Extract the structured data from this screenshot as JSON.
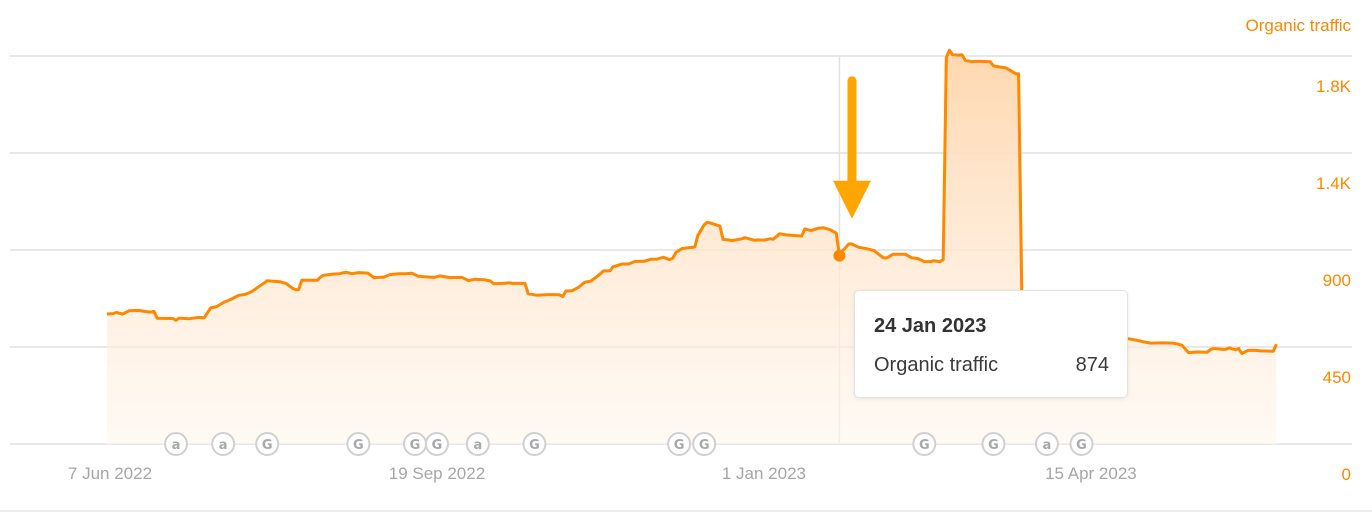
{
  "chart_data": {
    "type": "area",
    "title": "",
    "series_name": "Organic traffic",
    "xlabel": "",
    "ylabel": "Organic traffic",
    "axis_position": "right",
    "grid": true,
    "ylim": [
      0,
      1800
    ],
    "y_ticks": [
      {
        "value": 0,
        "label": "0"
      },
      {
        "value": 450,
        "label": "450"
      },
      {
        "value": 900,
        "label": "900"
      },
      {
        "value": 1350,
        "label": "1.4K"
      },
      {
        "value": 1800,
        "label": "1.8K"
      }
    ],
    "x_start_date": "2022-06-07",
    "x_range_days": [
      -1,
      372
    ],
    "x_ticks": [
      {
        "day": 0,
        "label": "7 Jun 2022"
      },
      {
        "day": 104,
        "label": "19 Sep 2022"
      },
      {
        "day": 208,
        "label": "1 Jan 2023"
      },
      {
        "day": 312,
        "label": "15 Apr 2023"
      }
    ],
    "color": "#ff8800",
    "points": [
      [
        -1,
        603
      ],
      [
        1,
        605
      ],
      [
        2,
        610
      ],
      [
        4,
        603
      ],
      [
        6,
        618
      ],
      [
        9,
        620
      ],
      [
        11,
        615
      ],
      [
        13,
        612
      ],
      [
        14,
        615
      ],
      [
        15,
        583
      ],
      [
        20,
        582
      ],
      [
        21,
        574
      ],
      [
        22,
        584
      ],
      [
        25,
        581
      ],
      [
        28,
        587
      ],
      [
        30,
        586
      ],
      [
        32,
        631
      ],
      [
        34,
        638
      ],
      [
        36,
        656
      ],
      [
        38,
        668
      ],
      [
        41,
        690
      ],
      [
        43,
        694
      ],
      [
        45,
        706
      ],
      [
        47,
        727
      ],
      [
        50,
        757
      ],
      [
        52,
        755
      ],
      [
        54,
        753
      ],
      [
        56,
        745
      ],
      [
        58,
        723
      ],
      [
        59,
        716
      ],
      [
        60,
        716
      ],
      [
        61,
        760
      ],
      [
        66,
        760
      ],
      [
        67,
        775
      ],
      [
        68,
        783
      ],
      [
        71,
        788
      ],
      [
        73,
        790
      ],
      [
        75,
        797
      ],
      [
        77,
        790
      ],
      [
        79,
        795
      ],
      [
        82,
        793
      ],
      [
        84,
        772
      ],
      [
        87,
        774
      ],
      [
        89,
        786
      ],
      [
        92,
        790
      ],
      [
        94,
        790
      ],
      [
        96,
        792
      ],
      [
        98,
        779
      ],
      [
        100,
        776
      ],
      [
        103,
        773
      ],
      [
        105,
        780
      ],
      [
        108,
        772
      ],
      [
        112,
        773
      ],
      [
        114,
        758
      ],
      [
        116,
        764
      ],
      [
        119,
        762
      ],
      [
        121,
        756
      ],
      [
        122,
        743
      ],
      [
        125,
        745
      ],
      [
        127,
        748
      ],
      [
        128,
        745
      ],
      [
        132,
        745
      ],
      [
        133,
        697
      ],
      [
        136,
        690
      ],
      [
        139,
        693
      ],
      [
        141,
        693
      ],
      [
        143,
        692
      ],
      [
        144,
        684
      ],
      [
        145,
        710
      ],
      [
        147,
        711
      ],
      [
        149,
        727
      ],
      [
        151,
        750
      ],
      [
        153,
        756
      ],
      [
        155,
        778
      ],
      [
        157,
        803
      ],
      [
        159,
        803
      ],
      [
        160,
        822
      ],
      [
        163,
        835
      ],
      [
        165,
        835
      ],
      [
        167,
        847
      ],
      [
        170,
        848
      ],
      [
        172,
        857
      ],
      [
        174,
        858
      ],
      [
        176,
        866
      ],
      [
        178,
        855
      ],
      [
        179,
        862
      ],
      [
        180,
        889
      ],
      [
        182,
        907
      ],
      [
        184,
        910
      ],
      [
        186,
        914
      ],
      [
        187,
        968
      ],
      [
        189,
        1017
      ],
      [
        190,
        1029
      ],
      [
        192,
        1020
      ],
      [
        194,
        1011
      ],
      [
        195,
        949
      ],
      [
        198,
        944
      ],
      [
        201,
        952
      ],
      [
        202,
        957
      ],
      [
        205,
        945
      ],
      [
        206,
        947
      ],
      [
        208,
        946
      ],
      [
        210,
        952
      ],
      [
        211,
        950
      ],
      [
        213,
        975
      ],
      [
        215,
        970
      ],
      [
        218,
        967
      ],
      [
        220,
        965
      ],
      [
        221,
        998
      ],
      [
        223,
        990
      ],
      [
        225,
        1000
      ],
      [
        227,
        1003
      ],
      [
        229,
        994
      ],
      [
        231,
        978
      ],
      [
        232,
        874
      ],
      [
        233,
        896
      ],
      [
        235,
        928
      ],
      [
        236,
        928
      ],
      [
        238,
        913
      ],
      [
        241,
        905
      ],
      [
        243,
        897
      ],
      [
        246,
        864
      ],
      [
        247,
        863
      ],
      [
        249,
        880
      ],
      [
        253,
        880
      ],
      [
        255,
        864
      ],
      [
        257,
        860
      ],
      [
        259,
        846
      ],
      [
        260,
        846
      ],
      [
        261,
        846
      ],
      [
        262,
        850
      ],
      [
        264,
        846
      ],
      [
        265,
        855
      ],
      [
        266,
        1792
      ],
      [
        267,
        1827
      ],
      [
        268,
        1806
      ],
      [
        270,
        1804
      ],
      [
        271,
        1806
      ],
      [
        272,
        1780
      ],
      [
        274,
        1774
      ],
      [
        276,
        1775
      ],
      [
        277,
        1775
      ],
      [
        280,
        1773
      ],
      [
        281,
        1754
      ],
      [
        283,
        1749
      ],
      [
        285,
        1745
      ],
      [
        287,
        1727
      ],
      [
        288,
        1718
      ],
      [
        289,
        1718
      ],
      [
        290,
        692
      ],
      [
        293,
        680
      ],
      [
        294,
        665
      ],
      [
        296,
        650
      ],
      [
        298,
        630
      ],
      [
        301,
        620
      ],
      [
        303,
        600
      ],
      [
        305,
        585
      ],
      [
        308,
        570
      ],
      [
        310,
        545
      ],
      [
        313,
        537
      ],
      [
        315,
        536
      ],
      [
        317,
        520
      ],
      [
        319,
        512
      ],
      [
        321,
        500
      ],
      [
        324,
        488
      ],
      [
        327,
        480
      ],
      [
        329,
        473
      ],
      [
        331,
        468
      ],
      [
        335,
        469
      ],
      [
        338,
        468
      ],
      [
        339,
        466
      ],
      [
        341,
        458
      ],
      [
        343,
        424
      ],
      [
        346,
        427
      ],
      [
        349,
        426
      ],
      [
        350,
        438
      ],
      [
        351,
        443
      ],
      [
        352,
        442
      ],
      [
        354,
        439
      ],
      [
        355,
        440
      ],
      [
        356,
        446
      ],
      [
        358,
        437
      ],
      [
        359,
        443
      ],
      [
        360,
        420
      ],
      [
        362,
        434
      ],
      [
        364,
        435
      ],
      [
        366,
        432
      ],
      [
        369,
        431
      ],
      [
        370,
        430
      ],
      [
        371,
        463
      ]
    ],
    "annotations": [
      {
        "day": 21,
        "type": "a"
      },
      {
        "day": 36,
        "type": "a"
      },
      {
        "day": 50,
        "type": "G"
      },
      {
        "day": 79,
        "type": "G"
      },
      {
        "day": 97,
        "type": "G"
      },
      {
        "day": 104,
        "type": "G"
      },
      {
        "day": 117,
        "type": "a"
      },
      {
        "day": 135,
        "type": "G"
      },
      {
        "day": 181,
        "type": "G"
      },
      {
        "day": 189,
        "type": "G"
      },
      {
        "day": 259,
        "type": "G"
      },
      {
        "day": 281,
        "type": "G"
      },
      {
        "day": 298,
        "type": "a"
      },
      {
        "day": 309,
        "type": "G"
      }
    ],
    "highlight": {
      "day": 232,
      "value": 874,
      "date_label": "24 Jan 2023"
    },
    "arrow": {
      "day": 236,
      "from_value": 1685,
      "to_value": 1045,
      "color": "#ffa500"
    }
  },
  "tooltip": {
    "date": "24 Jan 2023",
    "metric_label": "Organic traffic",
    "metric_value": "874"
  },
  "legend": {
    "series_title": "Organic traffic"
  }
}
